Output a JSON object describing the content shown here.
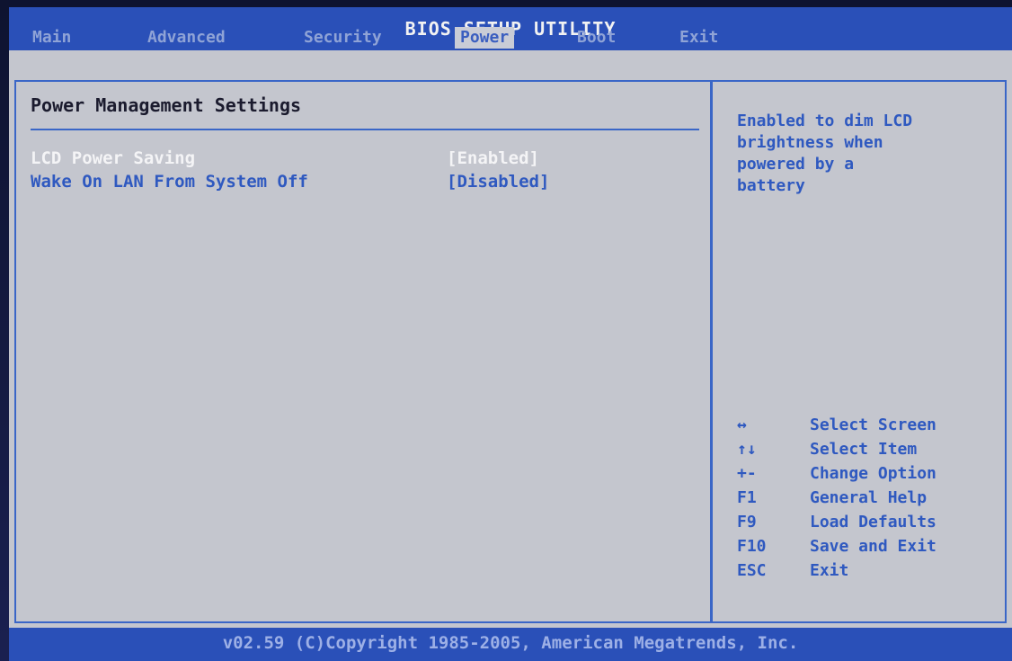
{
  "header": {
    "title": "BIOS SETUP UTILITY",
    "tabs": [
      {
        "label": "Main"
      },
      {
        "label": "Advanced"
      },
      {
        "label": "Security"
      },
      {
        "label": "Power"
      },
      {
        "label": "Boot"
      },
      {
        "label": "Exit"
      }
    ],
    "active_tab": "Power"
  },
  "main": {
    "section_title": "Power Management Settings",
    "settings": [
      {
        "label": "LCD Power Saving",
        "value": "[Enabled]",
        "selected": true
      },
      {
        "label": "Wake On LAN From System Off",
        "value": "[Disabled]",
        "selected": false
      }
    ]
  },
  "help": {
    "text": "Enabled to dim LCD\nbrightness when\npowered by a\nbattery"
  },
  "keys": [
    {
      "key": "↔",
      "desc": "Select Screen"
    },
    {
      "key": "↑↓",
      "desc": "Select Item"
    },
    {
      "key": "+-",
      "desc": "Change Option"
    },
    {
      "key": "F1",
      "desc": "General Help"
    },
    {
      "key": "F9",
      "desc": "Load Defaults"
    },
    {
      "key": "F10",
      "desc": "Save and Exit"
    },
    {
      "key": "ESC",
      "desc": "Exit"
    }
  ],
  "footer": {
    "text": "v02.59 (C)Copyright 1985-2005, American Megatrends, Inc."
  },
  "colors": {
    "bar_blue": "#2a50b8",
    "panel_gray": "#c4c6ce",
    "accent_blue": "#2f59c0",
    "selected_text": "#f4f4f6"
  }
}
